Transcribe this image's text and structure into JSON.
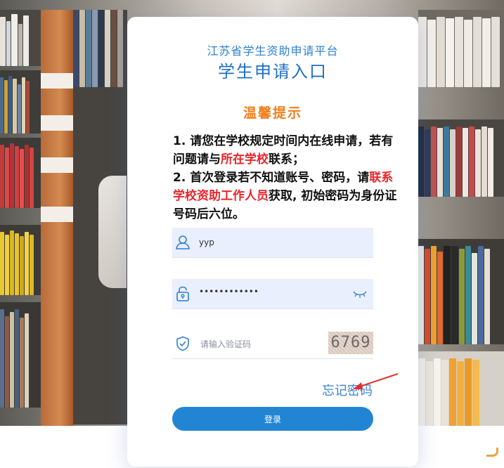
{
  "header": {
    "platform_title": "江苏省学生资助申请平台",
    "entry_title": "学生申请入口"
  },
  "notice": {
    "title": "温馨提示",
    "line1_a": "1. 请您在学校规定时间内在线申请，若有问题请与",
    "line1_red": "所在学校",
    "line1_b": "联系；",
    "line2_a": "2. 首次登录若不知道账号、密码，请",
    "line2_red": "联系学校资助工作人员",
    "line2_b": "获取, 初始密码为身份证号码后六位。"
  },
  "form": {
    "username_value": "yyp",
    "password_masked": "••••••••••••",
    "captcha_placeholder": "请输入验证码",
    "captcha_code": "6769",
    "forgot_label": "忘记密码",
    "login_label": "登录"
  },
  "icons": {
    "user": "user-icon",
    "lock": "lock-icon",
    "eye": "eye-closed-icon",
    "shield": "shield-check-icon"
  },
  "colors": {
    "primary": "#2185d4",
    "title_blue": "#1f6fc4",
    "notice_orange": "#f07f1d",
    "highlight_red": "#e8252b"
  }
}
